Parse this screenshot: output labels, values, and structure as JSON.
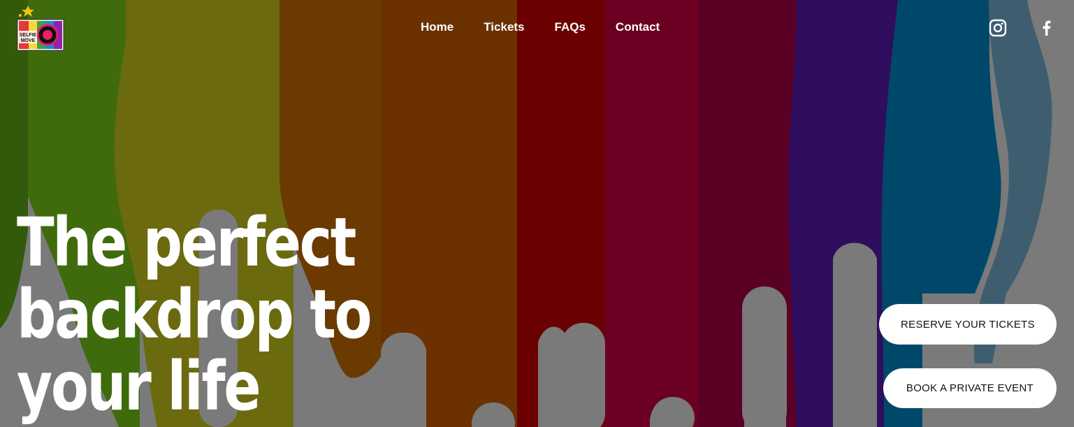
{
  "logo": {
    "text_line1": "SELFIE",
    "text_line2": "MOVE"
  },
  "nav": {
    "items": [
      {
        "label": "Home"
      },
      {
        "label": "Tickets"
      },
      {
        "label": "FAQs"
      },
      {
        "label": "Contact"
      }
    ]
  },
  "social": {
    "icons": [
      "instagram-icon",
      "facebook-icon"
    ]
  },
  "hero": {
    "headline_lines": [
      "The perfect",
      "backdrop to",
      "your life"
    ]
  },
  "cta": {
    "reserve_label": "RESERVE YOUR TICKETS",
    "private_label": "BOOK A PRIVATE EVENT"
  },
  "colors": {
    "overlay_gray": "#7a7a7a",
    "stripe_green": "#3f6b0c",
    "stripe_olive": "#6b6a0e",
    "stripe_orange": "#6b3100",
    "stripe_red": "#6b0000",
    "stripe_crimson": "#6b0022",
    "stripe_wine": "#5a0024",
    "stripe_purple": "#2e0d5e",
    "stripe_blue": "#00486a",
    "stripe_steel": "#3e5e70",
    "button_bg": "#ffffff",
    "text_white": "#ffffff"
  }
}
